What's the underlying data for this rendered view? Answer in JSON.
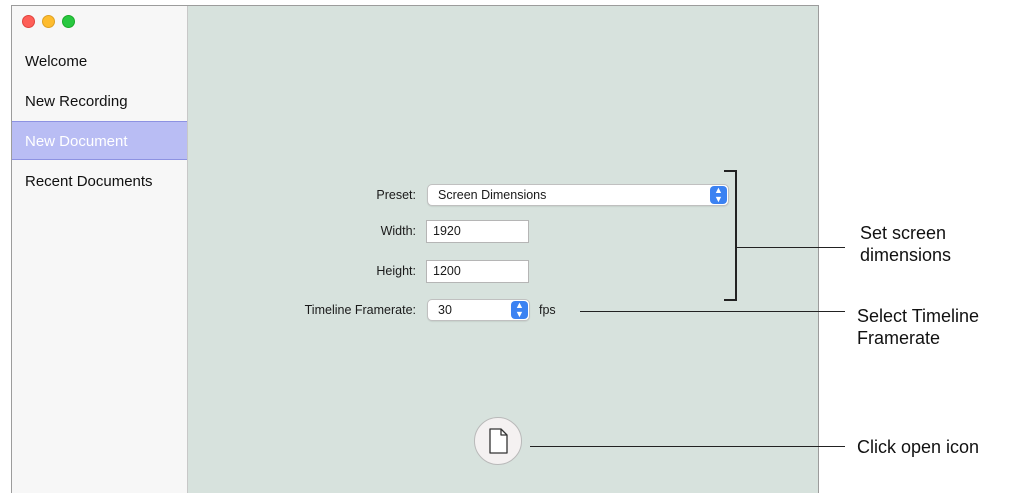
{
  "sidebar": {
    "items": [
      {
        "label": "Welcome"
      },
      {
        "label": "New Recording"
      },
      {
        "label": "New Document",
        "selected": true
      },
      {
        "label": "Recent Documents"
      }
    ]
  },
  "form": {
    "preset_label": "Preset:",
    "preset_value": "Screen Dimensions",
    "width_label": "Width:",
    "width_value": "1920",
    "height_label": "Height:",
    "height_value": "1200",
    "framerate_label": "Timeline Framerate:",
    "framerate_value": "30",
    "framerate_unit": "fps"
  },
  "open_button": {
    "icon": "document-icon"
  },
  "callouts": {
    "dimensions_line1": "Set screen",
    "dimensions_line2": "dimensions",
    "framerate_line1": "Select Timeline",
    "framerate_line2": "Framerate",
    "open_icon": "Click open icon"
  },
  "colors": {
    "content_bg": "#d7e2dd",
    "selected_bg": "#b9bdf4",
    "stepper_blue": "#3b82f2"
  }
}
